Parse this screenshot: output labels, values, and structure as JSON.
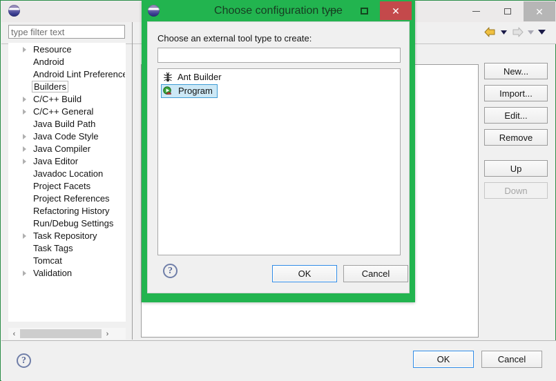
{
  "main_window": {
    "logo": "eclipse-logo",
    "window_controls": {
      "minimize": "–",
      "maximize": "□",
      "close": "✕"
    },
    "toolbar": {
      "back_icon": "back-arrow-icon",
      "back_menu_icon": "chevron-down-icon",
      "forward_icon": "forward-arrow-icon",
      "forward_menu_icon": "chevron-down-icon",
      "overflow_icon": "chevron-down-icon"
    },
    "filter": {
      "placeholder": "type filter text",
      "value": ""
    },
    "tree": [
      {
        "label": "Resource",
        "expandable": true,
        "selected": false
      },
      {
        "label": "Android",
        "expandable": false,
        "selected": false
      },
      {
        "label": "Android Lint Preferences",
        "expandable": false,
        "selected": false
      },
      {
        "label": "Builders",
        "expandable": false,
        "selected": true
      },
      {
        "label": "C/C++ Build",
        "expandable": true,
        "selected": false
      },
      {
        "label": "C/C++ General",
        "expandable": true,
        "selected": false
      },
      {
        "label": "Java Build Path",
        "expandable": false,
        "selected": false
      },
      {
        "label": "Java Code Style",
        "expandable": true,
        "selected": false
      },
      {
        "label": "Java Compiler",
        "expandable": true,
        "selected": false
      },
      {
        "label": "Java Editor",
        "expandable": true,
        "selected": false
      },
      {
        "label": "Javadoc Location",
        "expandable": false,
        "selected": false
      },
      {
        "label": "Project Facets",
        "expandable": false,
        "selected": false
      },
      {
        "label": "Project References",
        "expandable": false,
        "selected": false
      },
      {
        "label": "Refactoring History",
        "expandable": false,
        "selected": false
      },
      {
        "label": "Run/Debug Settings",
        "expandable": false,
        "selected": false
      },
      {
        "label": "Task Repository",
        "expandable": true,
        "selected": false
      },
      {
        "label": "Task Tags",
        "expandable": false,
        "selected": false
      },
      {
        "label": "Tomcat",
        "expandable": false,
        "selected": false
      },
      {
        "label": "Validation",
        "expandable": true,
        "selected": false
      }
    ],
    "hscrollbar": {
      "left_arrow": "‹",
      "right_arrow": "›"
    },
    "side_buttons": [
      {
        "label": "New...",
        "enabled": true
      },
      {
        "label": "Import...",
        "enabled": true
      },
      {
        "label": "Edit...",
        "enabled": true
      },
      {
        "label": "Remove",
        "enabled": true
      },
      {
        "label": "Up",
        "enabled": true
      },
      {
        "label": "Down",
        "enabled": false
      }
    ],
    "footer": {
      "help_icon": "help-question-icon",
      "help_glyph": "?",
      "ok_label": "OK",
      "cancel_label": "Cancel"
    }
  },
  "dialog": {
    "logo": "eclipse-logo",
    "title": "Choose configuration type",
    "window_controls": {
      "minimize": "–",
      "maximize": "□",
      "close": "✕"
    },
    "prompt": "Choose an external tool type to create:",
    "text_input": {
      "value": "",
      "placeholder": ""
    },
    "list": [
      {
        "label": "Ant Builder",
        "icon": "ant-icon",
        "selected": false
      },
      {
        "label": "Program",
        "icon": "program-run-icon",
        "selected": true
      }
    ],
    "footer": {
      "help_icon": "help-question-icon",
      "help_glyph": "?",
      "ok_label": "OK",
      "cancel_label": "Cancel"
    }
  },
  "colors": {
    "dialog_border_green": "#22b44f",
    "dialog_close_red": "#c4494b",
    "selection_blue": "#cce8f6",
    "selection_border": "#3c9bd4",
    "default_button_border": "#2e8ae5"
  }
}
